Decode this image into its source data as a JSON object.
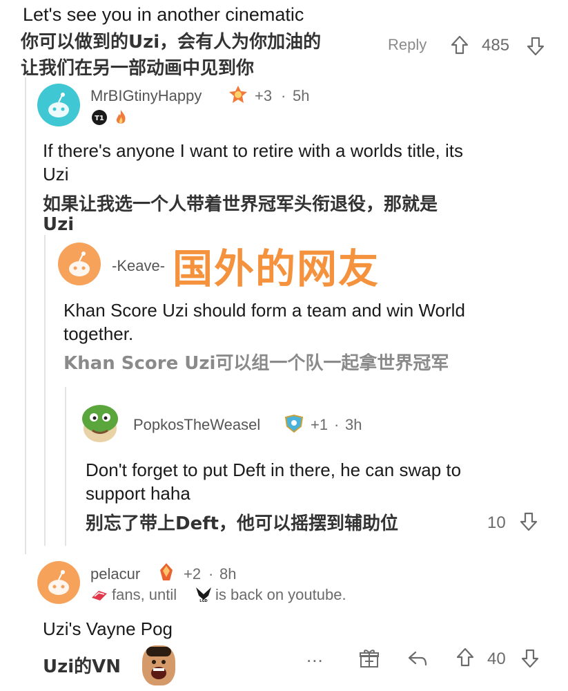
{
  "top_comment": {
    "text_en": "Let's see you in another cinematic",
    "text_cn_1": "你可以做到的Uzi，会有人为你加油的",
    "text_cn_2": "让我们在另一部动画中见到你",
    "reply_label": "Reply",
    "votes": "485"
  },
  "comment_mrbig": {
    "author": "MrBIGtinyHappy",
    "score": "+3",
    "time": "5h",
    "text_en_1": "If there's anyone I want to retire with a worlds title, its",
    "text_en_2": "Uzi",
    "text_cn_1": "如果让我选一个人带着世界冠军头衔退役，那就是",
    "text_cn_2": "Uzi"
  },
  "comment_keave": {
    "author": "-Keave-",
    "text_en_1": "Khan Score Uzi should form a team and win World",
    "text_en_2": "together.",
    "text_cn": "Khan Score Uzi可以组一个队一起拿世界冠军"
  },
  "overlay_caption": "国外的网友",
  "comment_popkos": {
    "author": "PopkosTheWeasel",
    "score": "+1",
    "time": "3h",
    "text_en_1": "Don't forget to put Deft in there, he can swap to",
    "text_en_2": "support haha",
    "text_cn": "别忘了带上Deft，他可以摇摆到辅助位",
    "votes": "10"
  },
  "comment_pelacur": {
    "author": "pelacur",
    "score": "+2",
    "time": "8h",
    "flair_1": "fans, until",
    "flair_2": "is back on youtube.",
    "text_en": "Uzi's Vayne Pog",
    "text_cn": "Uzi的VN",
    "more_label": "...",
    "votes": "40"
  },
  "separator": "·",
  "icons": {
    "upvote": "upvote-arrow-icon",
    "downvote": "downvote-arrow-icon",
    "reply": "reply-arrow-icon",
    "award": "gift-award-icon",
    "more": "more-dots-icon"
  }
}
